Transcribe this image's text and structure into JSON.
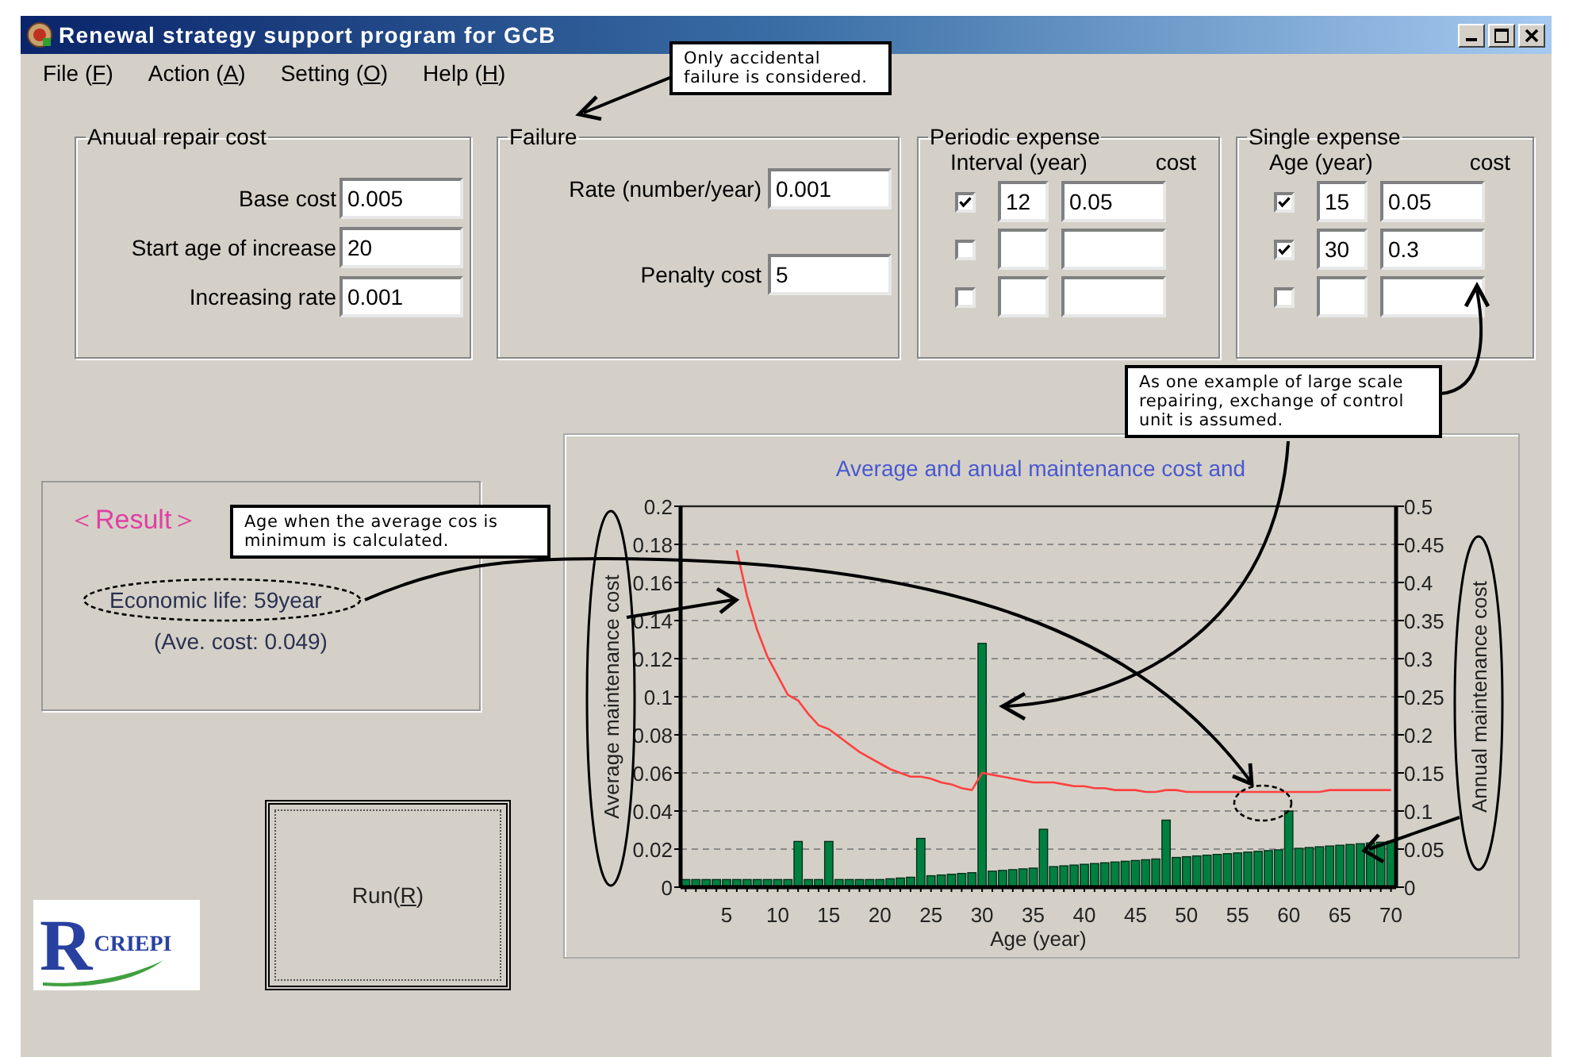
{
  "window": {
    "title": "Renewal strategy support program for GCB"
  },
  "menu": [
    {
      "before": "File (",
      "accelerator": "F",
      "after": ")"
    },
    {
      "before": "Action (",
      "accelerator": "A",
      "after": ")"
    },
    {
      "before": "Setting (",
      "accelerator": "O",
      "after": ")"
    },
    {
      "before": "Help (",
      "accelerator": "H",
      "after": ")"
    }
  ],
  "annual_repair_cost": {
    "title": "Anuual repair cost",
    "fields": [
      {
        "label": "Base cost",
        "value": "0.005"
      },
      {
        "label": "Start age of increase",
        "value": "20"
      },
      {
        "label": "Increasing rate",
        "value": "0.001"
      }
    ]
  },
  "failure": {
    "title": "Failure",
    "fields": [
      {
        "label": "Rate (number/year)",
        "value": "0.001"
      },
      {
        "label": "Penalty cost",
        "value": "5"
      }
    ]
  },
  "periodic_expense": {
    "title": "Periodic expense",
    "columns": [
      "Interval (year)",
      "cost"
    ],
    "rows": [
      {
        "checked": true,
        "value": "12",
        "cost": "0.05"
      },
      {
        "checked": false
      },
      {
        "checked": false
      }
    ]
  },
  "single_expense": {
    "title": "Single expense",
    "columns": [
      "Age (year)",
      "cost"
    ],
    "rows": [
      {
        "checked": true,
        "value": "15",
        "cost": "0.05"
      },
      {
        "checked": true,
        "value": "30",
        "cost": "0.3"
      },
      {
        "checked": false
      }
    ]
  },
  "result": {
    "title": "＜Result＞",
    "economic_life": "Economic life: 59year",
    "average_cost": "(Ave. cost: 0.049)"
  },
  "run_button": {
    "before": "Run(",
    "accelerator": "R",
    "after": ")"
  },
  "logo": {
    "letter": "R",
    "name": "CRIEPI"
  },
  "chart": {
    "chart_data": {
      "type": "bar",
      "title": "Average and anual maintenance cost and",
      "xlabel": "Age (year)",
      "ylabel": "Average maintenance cost",
      "y2label": "Annual maintenance cost",
      "grid": true,
      "x": [
        1,
        2,
        3,
        4,
        5,
        6,
        7,
        8,
        9,
        10,
        11,
        12,
        13,
        14,
        15,
        16,
        17,
        18,
        19,
        20,
        21,
        22,
        23,
        24,
        25,
        26,
        27,
        28,
        29,
        30,
        31,
        32,
        33,
        34,
        35,
        36,
        37,
        38,
        39,
        40,
        41,
        42,
        43,
        44,
        45,
        46,
        47,
        48,
        49,
        50,
        51,
        52,
        53,
        54,
        55,
        56,
        57,
        58,
        59,
        60,
        61,
        62,
        63,
        64,
        65,
        66,
        67,
        68,
        69,
        70
      ],
      "series": [
        {
          "axis": "y2",
          "color": "#008040",
          "values": [
            0.01,
            0.01,
            0.01,
            0.01,
            0.01,
            0.01,
            0.01,
            0.01,
            0.01,
            0.01,
            0.01,
            0.06,
            0.01,
            0.01,
            0.06,
            0.01,
            0.01,
            0.01,
            0.01,
            0.01,
            0.011,
            0.012,
            0.013,
            0.064,
            0.015,
            0.016,
            0.017,
            0.018,
            0.019,
            0.32,
            0.021,
            0.022,
            0.023,
            0.024,
            0.025,
            0.076,
            0.027,
            0.028,
            0.029,
            0.03,
            0.031,
            0.032,
            0.033,
            0.034,
            0.035,
            0.036,
            0.037,
            0.088,
            0.039,
            0.04,
            0.041,
            0.042,
            0.043,
            0.044,
            0.045,
            0.046,
            0.047,
            0.048,
            0.049,
            0.1,
            0.051,
            0.052,
            0.053,
            0.054,
            0.055,
            0.056,
            0.057,
            0.058,
            0.059,
            0.06
          ]
        },
        {
          "type": "line",
          "color": "#ff4040",
          "values": [
            null,
            null,
            null,
            null,
            null,
            0.177,
            0.153,
            0.135,
            0.121,
            0.111,
            0.101,
            0.098,
            0.091,
            0.085,
            0.083,
            0.079,
            0.075,
            0.071,
            0.068,
            0.065,
            0.062,
            0.06,
            0.058,
            0.058,
            0.057,
            0.055,
            0.054,
            0.052,
            0.051,
            0.06,
            0.059,
            0.058,
            0.057,
            0.056,
            0.055,
            0.055,
            0.055,
            0.054,
            0.053,
            0.053,
            0.052,
            0.052,
            0.051,
            0.051,
            0.051,
            0.05,
            0.05,
            0.051,
            0.051,
            0.05,
            0.05,
            0.05,
            0.05,
            0.05,
            0.05,
            0.05,
            0.05,
            0.05,
            0.05,
            0.05,
            0.05,
            0.05,
            0.05,
            0.051,
            0.051,
            0.051,
            0.051,
            0.051,
            0.051,
            0.051
          ]
        }
      ],
      "xlim": [
        0.5,
        70.5
      ],
      "ylim": [
        0,
        0.2
      ],
      "y2lim": [
        0,
        0.5
      ],
      "xticks": [
        5,
        10,
        15,
        20,
        25,
        30,
        35,
        40,
        45,
        50,
        55,
        60,
        65,
        70
      ],
      "yticks": [
        0,
        0.02,
        0.04,
        0.06,
        0.08,
        0.1,
        0.12,
        0.14,
        0.16,
        0.18,
        0.2
      ],
      "y2ticks": [
        0,
        0.05,
        0.1,
        0.15,
        0.2,
        0.25,
        0.3,
        0.35,
        0.4,
        0.45,
        0.5
      ]
    }
  },
  "callouts": [
    "Only accidental failure is considered.",
    "As one example of large scale repairing, exchange of control unit is assumed.",
    "Age when the average cos is minimum is calculated."
  ]
}
